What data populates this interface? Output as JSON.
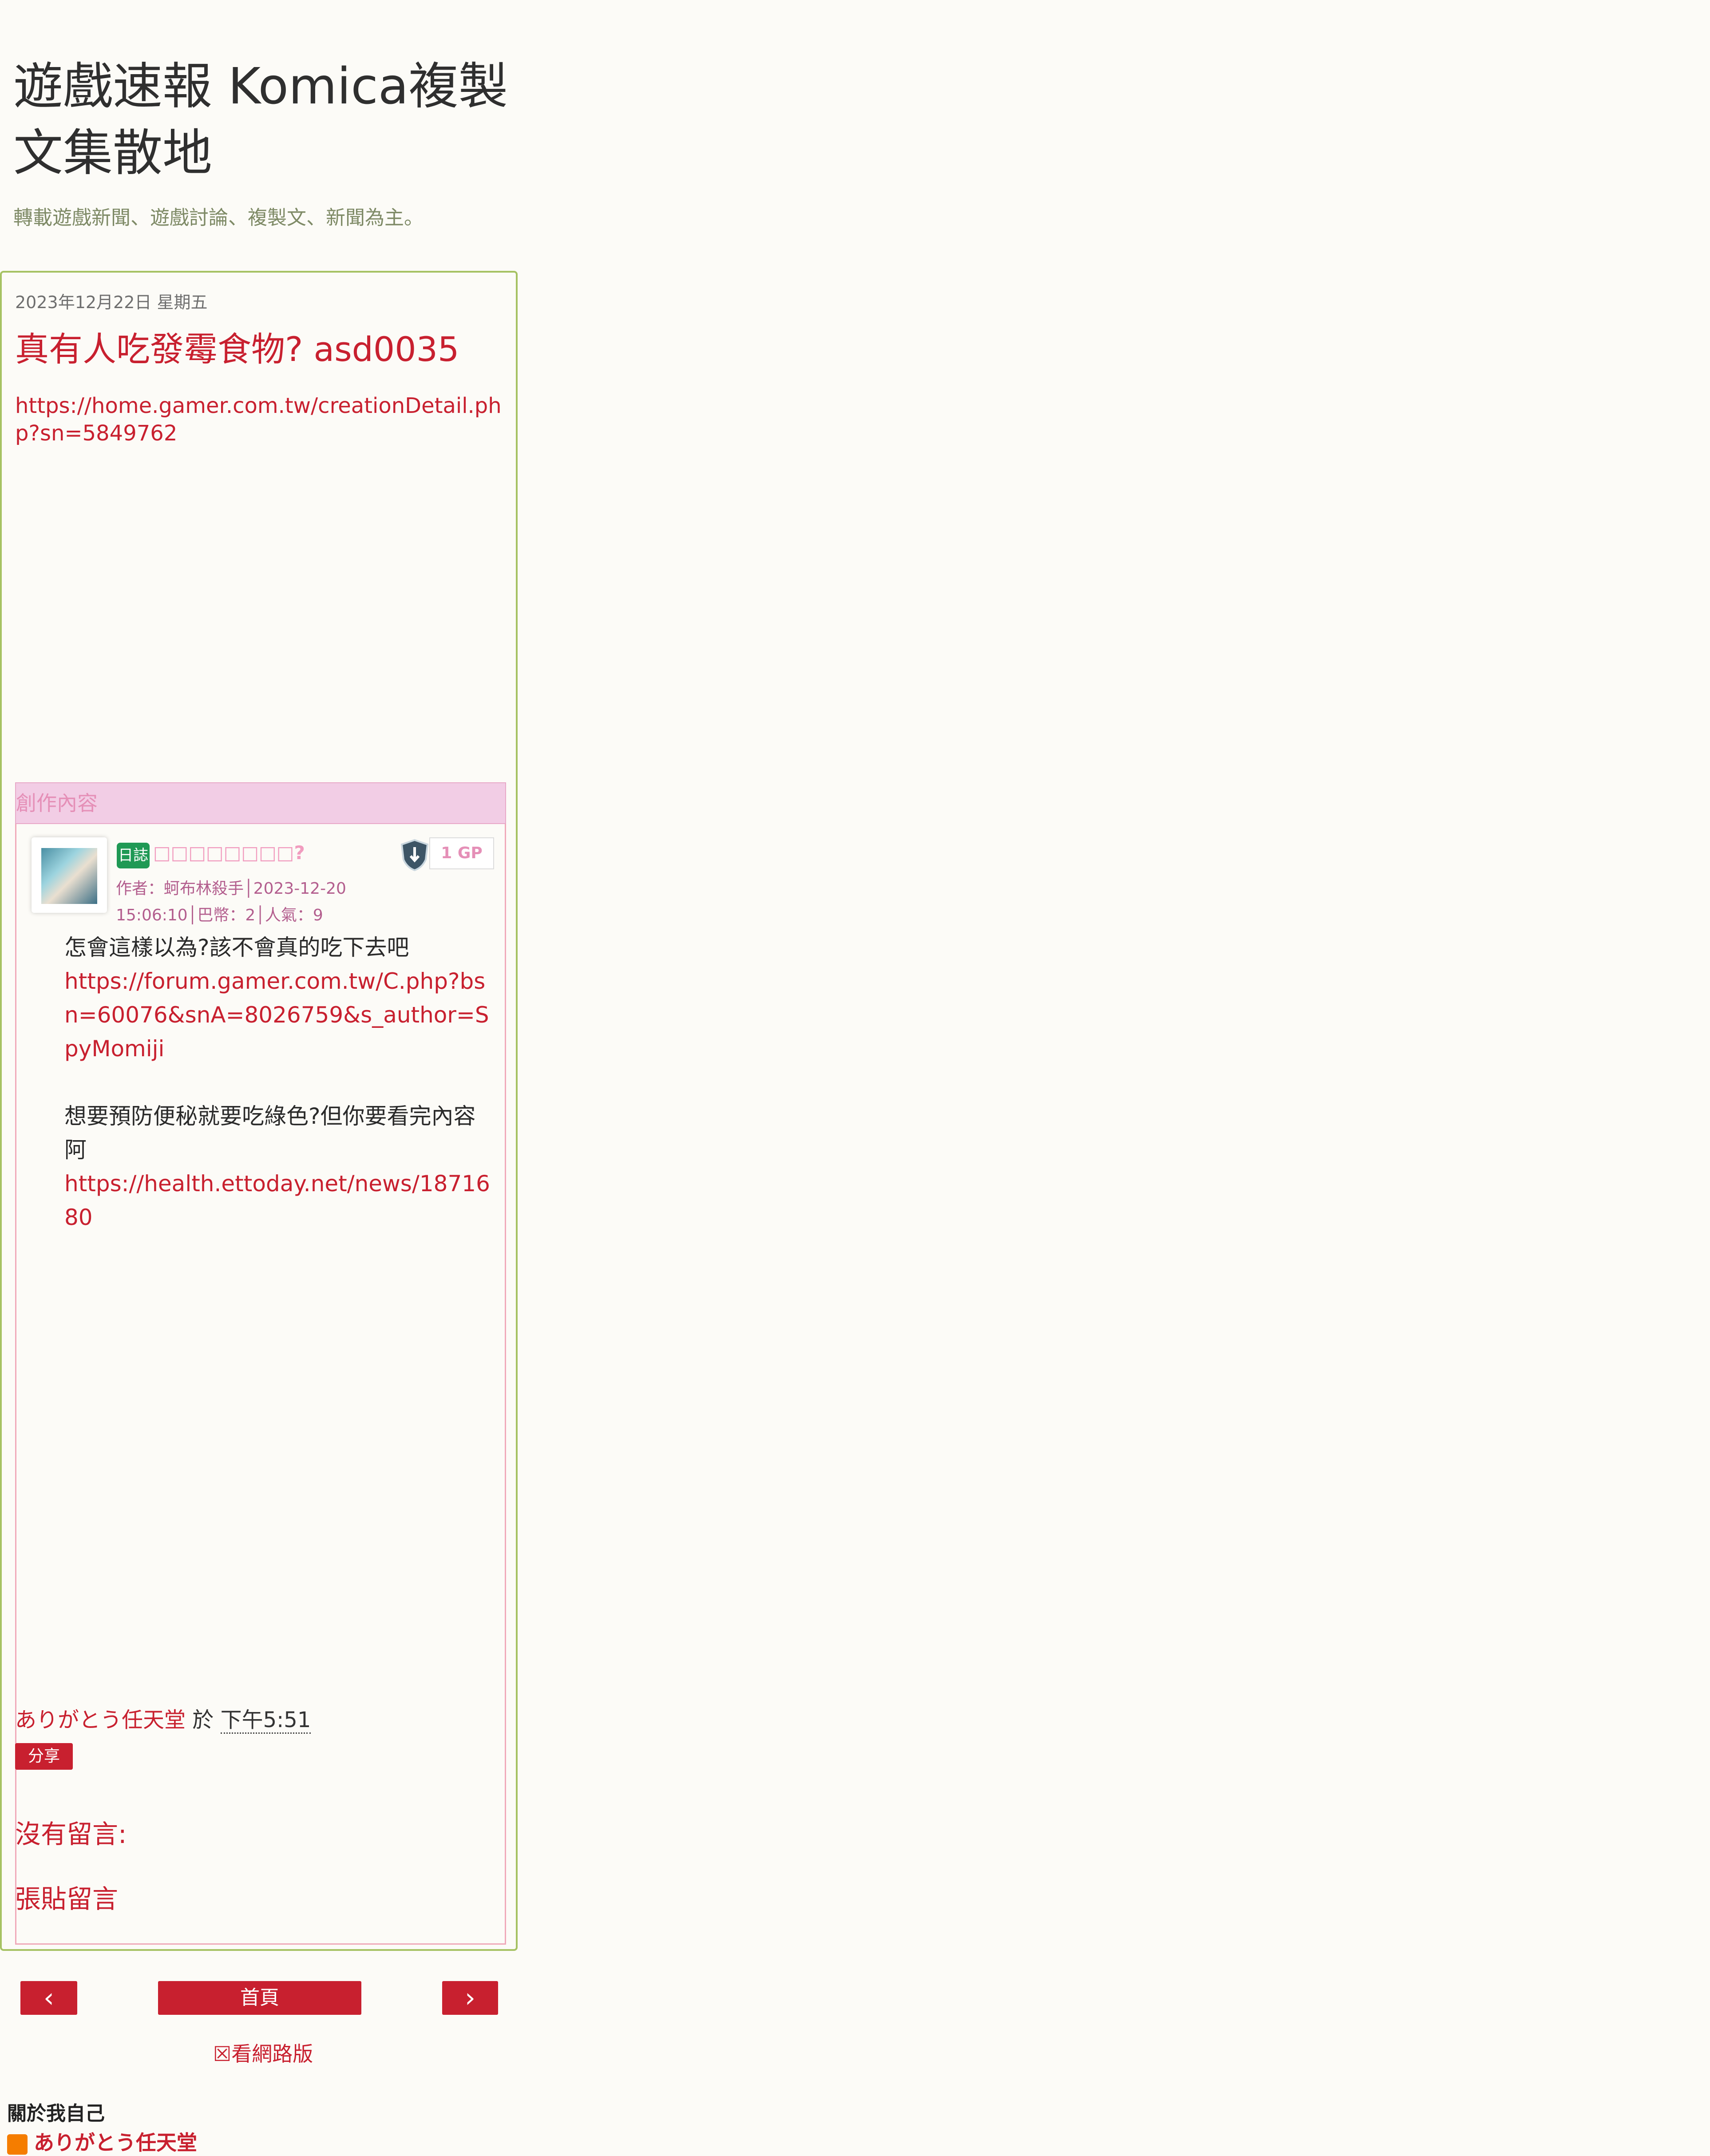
{
  "blog": {
    "title": "遊戲速報 Komica複製文集散地",
    "description": "轉載遊戲新聞、遊戲討論、複製文、新聞為主。"
  },
  "post": {
    "date": "2023年12月22日 星期五",
    "title": "真有人吃發霉食物? asd0035",
    "link": " https://home.gamer.com.tw/creationDetail.php?sn=5849762",
    "author": "ありがとう任天堂",
    "at": "於",
    "time": "下午5:51",
    "share_label": "分享",
    "no_comments": "沒有留言:",
    "post_comment": "張貼留言"
  },
  "embed": {
    "section_label": "創作內容",
    "badge": "日誌",
    "title": "□□□□□□□□?",
    "meta_line1": "作者：蚵布林殺手│2023-12-20",
    "meta_line2": "15:06:10│巴幣：2│人氣：9",
    "gp": "1 GP",
    "body": {
      "line1": "怎會這樣以為?該不會真的吃下去吧",
      "link1": "https://forum.gamer.com.tw/C.php?bsn=60076&snA=8026759&s_author=SpyMomiji",
      "line2": "想要預防便秘就要吃綠色?但你要看完內容阿",
      "link2": "https://health.ettoday.net/news/1871680"
    }
  },
  "nav": {
    "prev": "‹",
    "home": "首頁",
    "next": "›",
    "web_version": "☒看網路版"
  },
  "about": {
    "title": "關於我自己",
    "author": "ありがとう任天堂"
  },
  "colors": {
    "accent": "#c8202f",
    "card_border": "#a6c263",
    "section_bg": "#f2cde5",
    "badge_green": "#1f9955"
  }
}
